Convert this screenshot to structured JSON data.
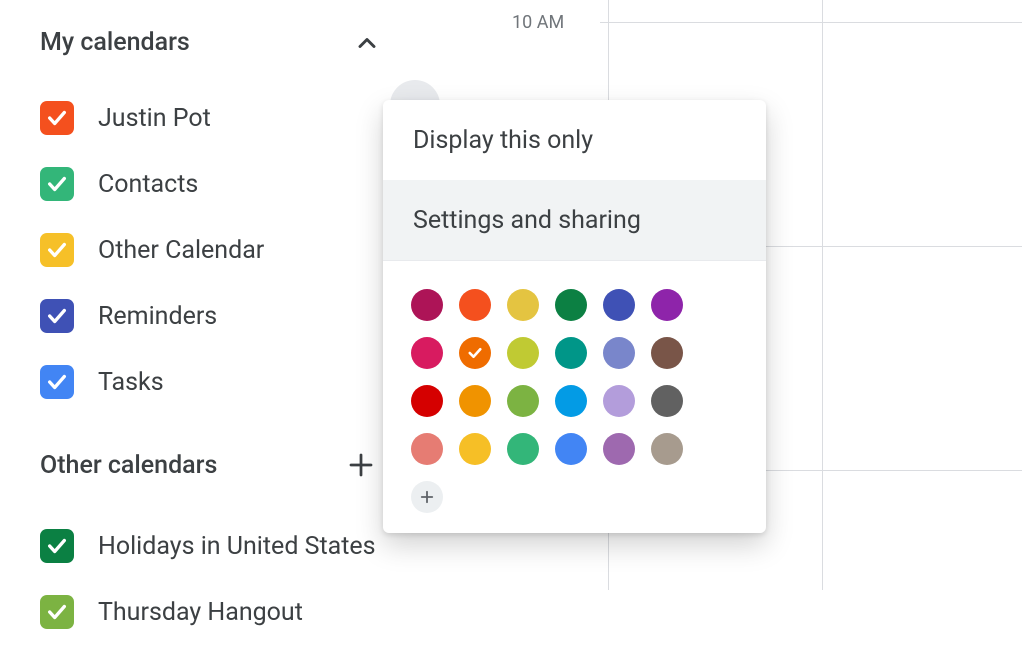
{
  "sidebar": {
    "my_title": "My calendars",
    "other_title": "Other calendars",
    "my_items": [
      {
        "label": "Justin Pot",
        "color": "#f4501e"
      },
      {
        "label": "Contacts",
        "color": "#33b679"
      },
      {
        "label": "Other Calendar",
        "color": "#f6c028"
      },
      {
        "label": "Reminders",
        "color": "#3f51b5"
      },
      {
        "label": "Tasks",
        "color": "#4285f4"
      }
    ],
    "other_items": [
      {
        "label": "Holidays in United States",
        "color": "#0b8043"
      },
      {
        "label": "Thursday Hangout",
        "color": "#7cb342"
      }
    ]
  },
  "grid": {
    "hour_label": "10 AM"
  },
  "popup": {
    "display_only": "Display this only",
    "settings": "Settings and sharing",
    "selected_index": 7,
    "colors": [
      "#ad1457",
      "#f4501e",
      "#e4c441",
      "#0c8043",
      "#3f51b5",
      "#8e24aa",
      "#d81b60",
      "#ef6c00",
      "#c0ca33",
      "#009688",
      "#7986cb",
      "#795548",
      "#d50000",
      "#f09300",
      "#7cb342",
      "#039be5",
      "#b39ddb",
      "#616161",
      "#e67c73",
      "#f6bf26",
      "#33b679",
      "#4285f4",
      "#9e69af",
      "#a79b8e"
    ]
  }
}
